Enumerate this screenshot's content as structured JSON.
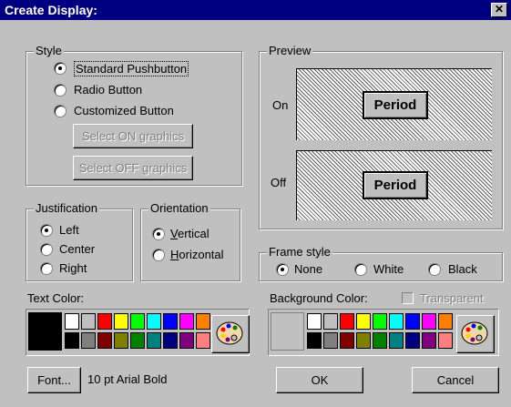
{
  "window": {
    "title": "Create Display:",
    "close_glyph": "✕"
  },
  "style": {
    "legend": "Style",
    "options": [
      "Standard Pushbutton",
      "Radio Button",
      "Customized Button"
    ],
    "selected": 0,
    "select_on_label": "Select ON graphics",
    "select_off_label": "Select OFF graphics"
  },
  "preview": {
    "legend": "Preview",
    "on_label": "On",
    "off_label": "Off",
    "button_label": "Period"
  },
  "justification": {
    "legend": "Justification",
    "options": [
      "Left",
      "Center",
      "Right"
    ],
    "selected": 0
  },
  "orientation": {
    "legend": "Orientation",
    "vertical_first": "V",
    "vertical_rest": "ertical",
    "horizontal_first": "H",
    "horizontal_rest": "orizontal",
    "selected": "Vertical"
  },
  "frame_style": {
    "legend": "Frame style",
    "options": [
      "None",
      "White",
      "Black"
    ],
    "selected": 0
  },
  "text_color": {
    "label": "Text Color:",
    "current": "#000000",
    "palette_top": [
      "#ffffff",
      "#c0c0c0",
      "#ff0000",
      "#ffff00",
      "#00ff00",
      "#00ffff",
      "#0000ff",
      "#ff00ff",
      "#ff8000"
    ],
    "palette_bottom": [
      "#000000",
      "#808080",
      "#800000",
      "#808000",
      "#008000",
      "#008080",
      "#000080",
      "#800080",
      "#ff8080"
    ]
  },
  "background_color": {
    "label": "Background Color:",
    "current": "#c0c0c0",
    "transparent_label": "Transparent",
    "palette_top": [
      "#ffffff",
      "#c0c0c0",
      "#ff0000",
      "#ffff00",
      "#00ff00",
      "#00ffff",
      "#0000ff",
      "#ff00ff",
      "#ff8000"
    ],
    "palette_bottom": [
      "#000000",
      "#808080",
      "#800000",
      "#808000",
      "#008000",
      "#008080",
      "#000080",
      "#800080",
      "#ff8080"
    ]
  },
  "font": {
    "button_label": "Font...",
    "description": "10 pt Arial Bold"
  },
  "buttons": {
    "ok": "OK",
    "cancel": "Cancel"
  },
  "icons": {
    "palette": "palette-icon",
    "close": "close-icon"
  }
}
